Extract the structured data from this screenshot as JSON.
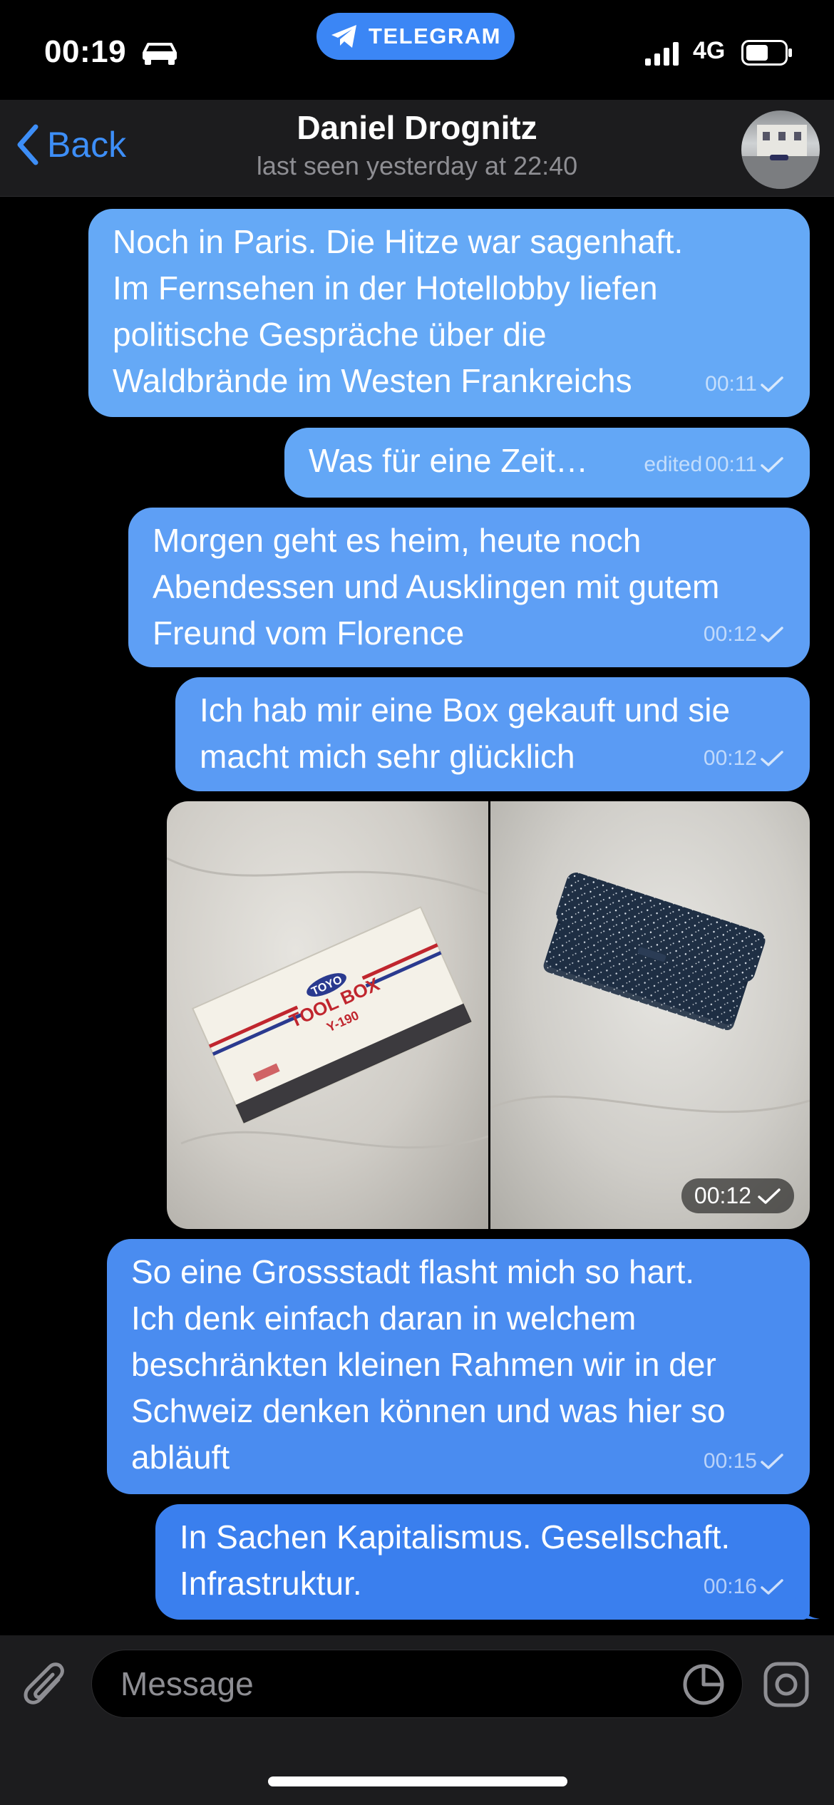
{
  "status_bar": {
    "time": "00:19",
    "network": "4G",
    "app_pill": "TELEGRAM"
  },
  "header": {
    "back_label": "Back",
    "name": "Daniel Drognitz",
    "last_seen": "last seen yesterday at 22:40"
  },
  "messages": [
    {
      "text": "Noch in Paris. Die Hitze war sagenhaft.\nIm Fernsehen in der Hotellobby liefen\npolitische Gespräche über die\nWaldbrände im Westen Frankreichs",
      "time": "00:11",
      "edited": ""
    },
    {
      "text": "Was für eine Zeit…",
      "time": "00:11",
      "edited": "edited"
    },
    {
      "text": "Morgen geht es heim, heute noch\nAbendessen und Ausklingen mit gutem\nFreund vom Florence",
      "time": "00:12",
      "edited": ""
    },
    {
      "text": "Ich hab mir eine Box gekauft und sie\nmacht mich sehr glücklich",
      "time": "00:12",
      "edited": ""
    },
    {
      "text": "So eine Grossstadt flasht mich so hart.\nIch denk einfach daran in welchem\nbeschränkten kleinen Rahmen wir in der\nSchweiz denken können und was hier so\nabläuft",
      "time": "00:15",
      "edited": ""
    },
    {
      "text": "In Sachen Kapitalismus. Gesellschaft.\nInfrastruktur.",
      "time": "00:16",
      "edited": ""
    }
  ],
  "photos": {
    "time": "00:12",
    "box_brand": "TOYO",
    "box_label": "TOOL BOX",
    "box_model": "Y-190"
  },
  "composer": {
    "placeholder": "Message"
  },
  "colors": {
    "accent": "#3d8ef7",
    "bubble_top": "#6aaef6",
    "bubble_bottom": "#3a7fee",
    "header_bg": "#1c1c1e"
  },
  "icons": [
    "car-icon",
    "telegram-icon",
    "signal-icon",
    "battery-icon",
    "chevron-left-icon",
    "check-icon",
    "paperclip-icon",
    "sticker-icon",
    "camera-icon"
  ]
}
